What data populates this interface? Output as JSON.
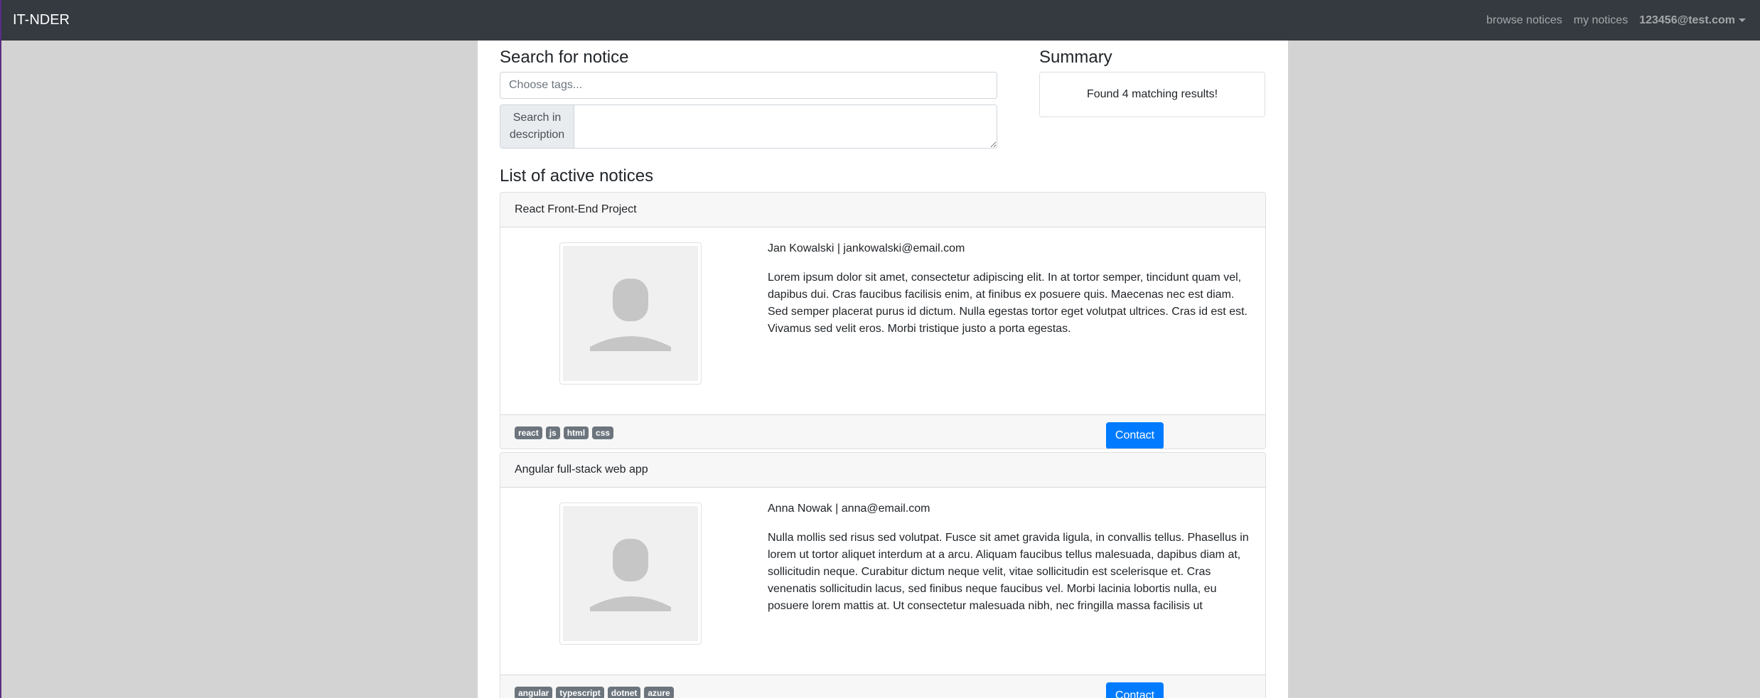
{
  "navbar": {
    "brand": "IT-NDER",
    "links": [
      "browse notices",
      "my notices"
    ],
    "user": "123456@test.com"
  },
  "search": {
    "title": "Search for notice",
    "tags_placeholder": "Choose tags...",
    "description_label": "Search in description",
    "description_value": ""
  },
  "summary": {
    "title": "Summary",
    "text": "Found 4 matching results!"
  },
  "list": {
    "title": "List of active notices",
    "notices": [
      {
        "title": "React Front-End Project",
        "contact": "Jan Kowalski | jankowalski@email.com",
        "description": "Lorem ipsum dolor sit amet, consectetur adipiscing elit. In at tortor semper, tincidunt quam vel, dapibus dui. Cras faucibus facilisis enim, at finibus ex posuere quis. Maecenas nec est diam. Sed semper placerat purus id dictum. Nulla egestas tortor eget volutpat ultrices. Cras id est est. Vivamus sed velit eros. Morbi tristique justo a porta egestas.",
        "tags": [
          "react",
          "js",
          "html",
          "css"
        ],
        "button": "Contact"
      },
      {
        "title": "Angular full-stack web app",
        "contact": "Anna Nowak | anna@email.com",
        "description": "Nulla mollis sed risus sed volutpat. Fusce sit amet gravida ligula, in convallis tellus. Phasellus in lorem ut tortor aliquet interdum at a arcu. Aliquam faucibus tellus malesuada, dapibus diam at, sollicitudin neque. Curabitur dictum neque velit, vitae sollicitudin est scelerisque et. Cras venenatis sollicitudin lacus, sed finibus neque faucibus vel. Morbi lacinia lobortis nulla, eu posuere lorem mattis at. Ut consectetur malesuada nibh, nec fringilla massa facilisis ut",
        "tags": [
          "angular",
          "typescript",
          "dotnet",
          "azure"
        ],
        "button": "Contact"
      }
    ]
  },
  "icons": {
    "avatar": "user-placeholder-icon",
    "dropdown": "caret-down-icon"
  }
}
